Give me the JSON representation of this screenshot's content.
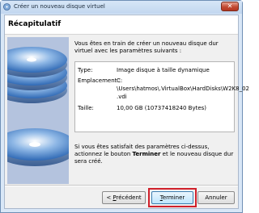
{
  "window": {
    "title": "Créer un nouveau disque virtuel",
    "close_label": "✕"
  },
  "page": {
    "title": "Récapitulatif"
  },
  "intro_text": "Vous êtes en train de créer un nouveau disque dur virtuel avec les paramètres suivants :",
  "summary": {
    "type_label": "Type:",
    "type_value": "Image disque à taille dynamique",
    "location_label": "Emplacement :",
    "location_line1": "C:",
    "location_line2": "\\Users\\hatmos\\.VirtualBox\\HardDisks\\W2K8_02",
    "location_line3": ".vdi",
    "size_label": "Taille:",
    "size_value": "10,00 GB (10737418240 Bytes)"
  },
  "outro": {
    "part1": "Si vous êtes satisfait des paramètres ci-dessus, actionnez le bouton ",
    "bold": "Terminer",
    "part2": " et le nouveau disque dur sera créé."
  },
  "buttons": {
    "prev_prefix": "< ",
    "prev_mnemonic": "P",
    "prev_rest": "récédent",
    "finish_mnemonic": "T",
    "finish_rest": "erminer",
    "cancel": "Annuler"
  },
  "colors": {
    "title_bar": "#c9dcf2",
    "highlight": "#d0202a",
    "disk_blue": "#3a7fd0"
  }
}
